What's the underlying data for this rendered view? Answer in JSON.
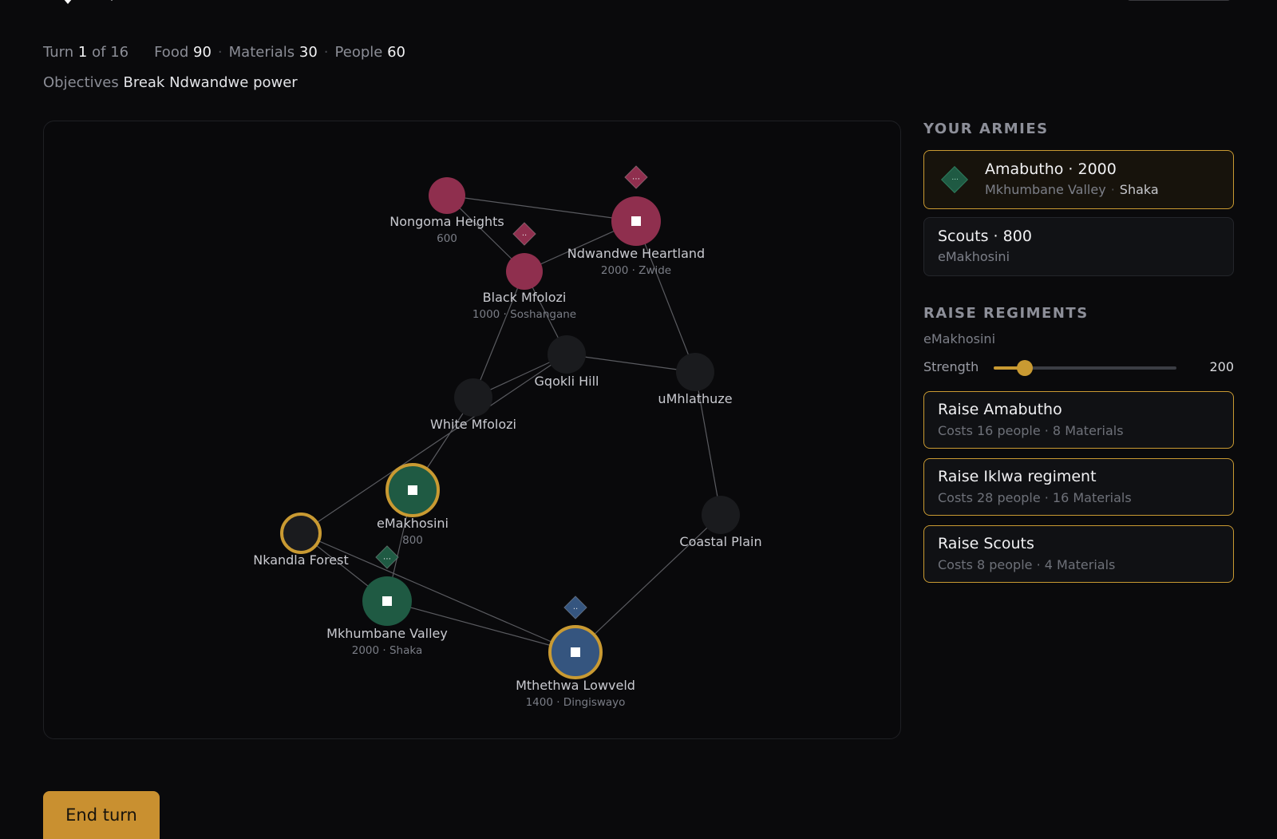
{
  "status": {
    "turn_label": "Turn",
    "turn": "1",
    "of_label": "of",
    "total_turns": "16",
    "food_label": "Food",
    "food": "90",
    "materials_label": "Materials",
    "materials": "30",
    "people_label": "People",
    "people": "60",
    "separator": "·"
  },
  "objectives": {
    "label": "Objectives",
    "text": "Break Ndwandwe power"
  },
  "colors": {
    "ndwandwe": "#8f2f4e",
    "zulu": "#1f5a43",
    "mthethwa": "#35557f",
    "neutral": "#1a1b1e",
    "ring": "#c99a32",
    "edge": "#5a5b60"
  },
  "map": {
    "regions": [
      {
        "id": "nongoma",
        "name": "Nongoma Heights",
        "sub": "600",
        "faction": "ndwandwe",
        "capital": false,
        "ring": false
      },
      {
        "id": "heartland",
        "name": "Ndwandwe Heartland",
        "sub": "2000 · Zwide",
        "faction": "ndwandwe",
        "capital": true,
        "ring": false
      },
      {
        "id": "black",
        "name": "Black Mfolozi",
        "sub": "1000 · Soshangane",
        "faction": "ndwandwe",
        "capital": false,
        "ring": false
      },
      {
        "id": "gqokli",
        "name": "Gqokli Hill",
        "sub": "",
        "faction": "neutral",
        "capital": false,
        "ring": false
      },
      {
        "id": "umhlathuze",
        "name": "uMhlathuze",
        "sub": "",
        "faction": "neutral",
        "capital": false,
        "ring": false
      },
      {
        "id": "white",
        "name": "White Mfolozi",
        "sub": "",
        "faction": "neutral",
        "capital": false,
        "ring": false
      },
      {
        "id": "emakhosini",
        "name": "eMakhosini",
        "sub": "800",
        "faction": "zulu",
        "capital": true,
        "ring": true
      },
      {
        "id": "nkandla",
        "name": "Nkandla Forest",
        "sub": "",
        "faction": "neutral",
        "capital": false,
        "ring": true
      },
      {
        "id": "coastal",
        "name": "Coastal Plain",
        "sub": "",
        "faction": "neutral",
        "capital": false,
        "ring": false
      },
      {
        "id": "mkhumbane",
        "name": "Mkhumbane Valley",
        "sub": "2000 · Shaka",
        "faction": "zulu",
        "capital": true,
        "ring": false
      },
      {
        "id": "mthethwa",
        "name": "Mthethwa Lowveld",
        "sub": "1400 · Dingiswayo",
        "faction": "mthethwa",
        "capital": true,
        "ring": true
      }
    ],
    "edges": [
      [
        "nongoma",
        "heartland"
      ],
      [
        "nongoma",
        "black"
      ],
      [
        "black",
        "heartland"
      ],
      [
        "black",
        "white"
      ],
      [
        "black",
        "gqokli"
      ],
      [
        "heartland",
        "umhlathuze"
      ],
      [
        "gqokli",
        "umhlathuze"
      ],
      [
        "gqokli",
        "white"
      ],
      [
        "gqokli",
        "nkandla"
      ],
      [
        "white",
        "emakhosini"
      ],
      [
        "umhlathuze",
        "coastal"
      ],
      [
        "coastal",
        "mthethwa"
      ],
      [
        "emakhosini",
        "mkhumbane"
      ],
      [
        "nkandla",
        "mkhumbane"
      ],
      [
        "nkandla",
        "mthethwa"
      ],
      [
        "mkhumbane",
        "mthethwa"
      ]
    ],
    "army_markers": [
      {
        "region": "heartland",
        "faction": "ndwandwe",
        "glyph": "⋯"
      },
      {
        "region": "black",
        "faction": "ndwandwe",
        "glyph": "··"
      },
      {
        "region": "mkhumbane",
        "faction": "zulu",
        "glyph": "⋯"
      },
      {
        "region": "mthethwa",
        "faction": "mthethwa",
        "glyph": "··"
      }
    ]
  },
  "panel": {
    "armies_title": "Your armies",
    "armies": [
      {
        "title": "Amabutho · 2000",
        "location": "Mkhumbane Valley",
        "commander": "Shaka",
        "selected": true,
        "icon": "army-diamond-icon"
      },
      {
        "title": "Scouts · 800",
        "location": "eMakhosini",
        "commander": "",
        "selected": false
      }
    ],
    "raise_title": "Raise regiments",
    "raise_region": "eMakhosini",
    "strength_label": "Strength",
    "strength_value": "200",
    "strength_fraction": 0.17,
    "raise_options": [
      {
        "title": "Raise Amabutho",
        "cost": "Costs 16 people · 8 Materials"
      },
      {
        "title": "Raise Iklwa regiment",
        "cost": "Costs 28 people · 16 Materials"
      },
      {
        "title": "Raise Scouts",
        "cost": "Costs 8 people · 4 Materials"
      }
    ]
  },
  "end_turn_label": "End turn"
}
